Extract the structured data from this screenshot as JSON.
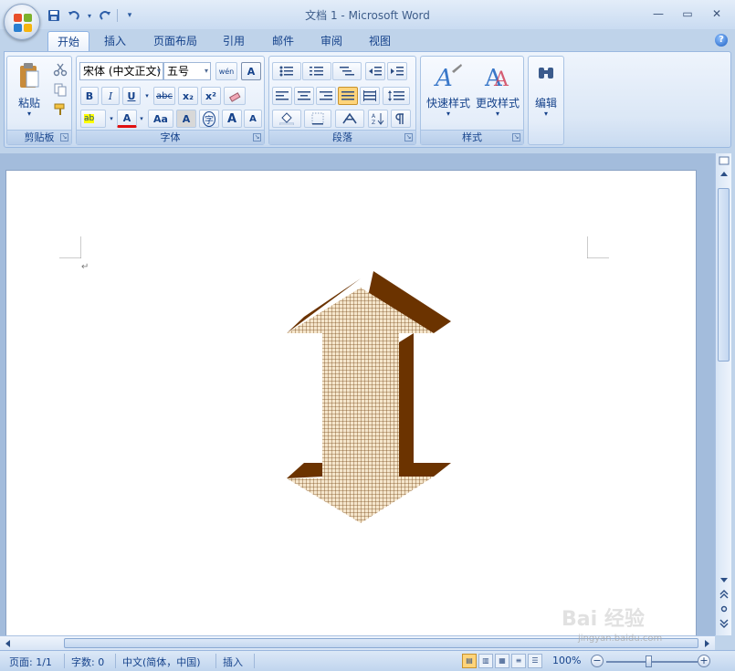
{
  "window": {
    "title": "文档 1 - Microsoft Word",
    "qat_separator": "|",
    "minimize_glyph": "—",
    "maximize_glyph": "▭",
    "close_glyph": "✕",
    "help_glyph": "?"
  },
  "tabs": [
    {
      "label": "开始",
      "active": true
    },
    {
      "label": "插入"
    },
    {
      "label": "页面布局"
    },
    {
      "label": "引用"
    },
    {
      "label": "邮件"
    },
    {
      "label": "审阅"
    },
    {
      "label": "视图"
    }
  ],
  "ribbon": {
    "groups": {
      "clipboard": "剪贴板",
      "font": "字体",
      "paragraph": "段落",
      "styles": "样式"
    },
    "launcher_glyph": "↘",
    "dropdown_glyph": "▾",
    "paste_label": "粘贴",
    "font_name": "宋体 (中文正文)",
    "font_size": "五号",
    "phonetic_glyph": "wén",
    "bold": "B",
    "italic": "I",
    "underline": "U",
    "strikethrough": "abc",
    "subscript": "x₂",
    "superscript": "x²",
    "change_case": "Aa",
    "char_shading": "A",
    "enclose_char": "字",
    "grow_font": "A",
    "shrink_font": "A",
    "font_color": "A",
    "highlight": "ab",
    "quick_styles": "快速样式",
    "change_styles": "更改样式",
    "editing": "编辑"
  },
  "document": {
    "paragraph_mark": "↵",
    "shape": {
      "type": "up-down-arrow",
      "fill_pattern": "grid",
      "fill_color": "#f5e6cc",
      "pattern_color": "#7a4a1a",
      "extrusion_color": "#6b3300"
    }
  },
  "statusbar": {
    "page": "页面: 1/1",
    "words": "字数: 0",
    "language": "中文(简体，中国)",
    "mode": "插入",
    "zoom": "100%",
    "zoom_minus": "−",
    "zoom_plus": "+"
  },
  "watermark": {
    "brand": "Bai 经验",
    "url": "jingyan.baidu.com"
  },
  "colors": {
    "ribbon_text": "#15428b",
    "active_tab": "#ffffff",
    "selected_button": "#ffd47a"
  }
}
